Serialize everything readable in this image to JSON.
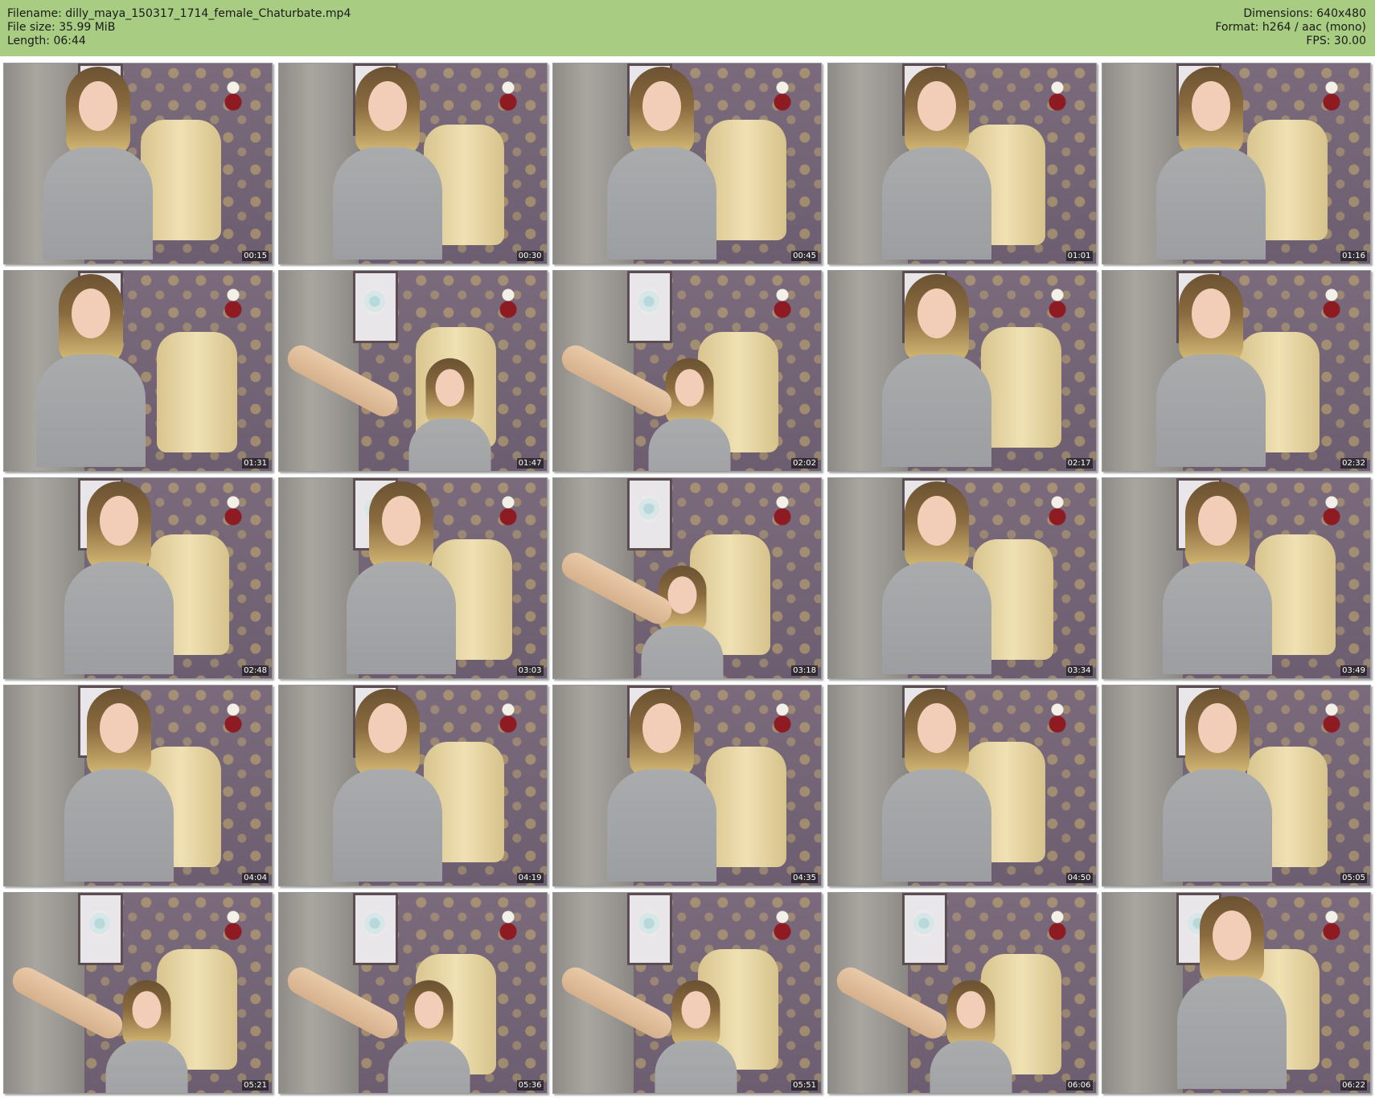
{
  "header": {
    "filename_label": "Filename: dilly_maya_150317_1714_female_Chaturbate.mp4",
    "filesize_label": "File size: 35.99 MiB",
    "length_label": "Length: 06:44",
    "dimensions_label": "Dimensions: 640x480",
    "format_label": "Format: h264 / aac (mono)",
    "fps_label": "FPS: 30.00"
  },
  "colors": {
    "header_bg": "#a8cc82",
    "page_bg": "#ffffff"
  },
  "thumbnails": [
    {
      "time": "00:15"
    },
    {
      "time": "00:30"
    },
    {
      "time": "00:45"
    },
    {
      "time": "01:01"
    },
    {
      "time": "01:16"
    },
    {
      "time": "01:31"
    },
    {
      "time": "01:47"
    },
    {
      "time": "02:02"
    },
    {
      "time": "02:17"
    },
    {
      "time": "02:32"
    },
    {
      "time": "02:48"
    },
    {
      "time": "03:03"
    },
    {
      "time": "03:18"
    },
    {
      "time": "03:34"
    },
    {
      "time": "03:49"
    },
    {
      "time": "04:04"
    },
    {
      "time": "04:19"
    },
    {
      "time": "04:35"
    },
    {
      "time": "04:50"
    },
    {
      "time": "05:05"
    },
    {
      "time": "05:21"
    },
    {
      "time": "05:36"
    },
    {
      "time": "05:51"
    },
    {
      "time": "06:06"
    },
    {
      "time": "06:22"
    }
  ]
}
